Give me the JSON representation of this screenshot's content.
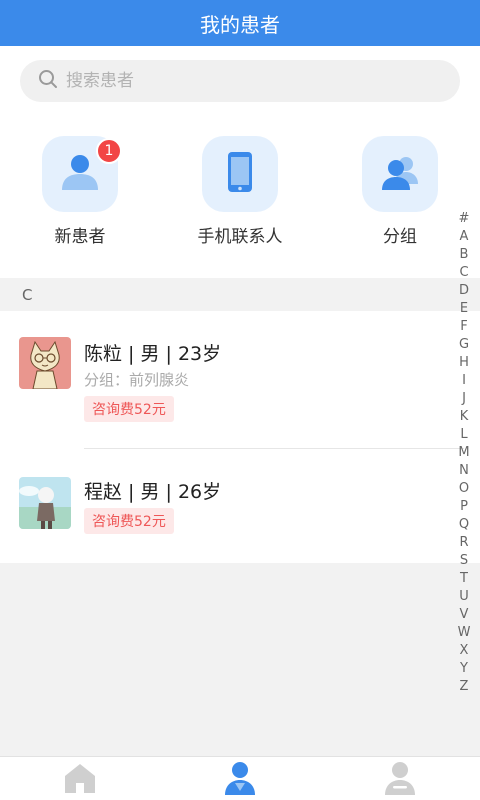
{
  "header": {
    "title": "我的患者"
  },
  "search": {
    "placeholder": "搜索患者"
  },
  "quick_actions": {
    "new_patients": {
      "label": "新患者",
      "badge": "1"
    },
    "contacts": {
      "label": "手机联系人"
    },
    "groups": {
      "label": "分组"
    }
  },
  "section": {
    "letter": "C"
  },
  "patients": [
    {
      "title": "陈粒 | 男 | 23岁",
      "group": "分组：前列腺炎",
      "fee": "咨询费52元"
    },
    {
      "title": "程赵 | 男 | 26岁",
      "fee": "咨询费52元"
    }
  ],
  "alphabet": [
    "#",
    "A",
    "B",
    "C",
    "D",
    "E",
    "F",
    "G",
    "H",
    "I",
    "J",
    "K",
    "L",
    "M",
    "N",
    "O",
    "P",
    "Q",
    "R",
    "S",
    "T",
    "U",
    "V",
    "W",
    "X",
    "Y",
    "Z"
  ],
  "colors": {
    "primary": "#3b8aea",
    "badge": "#f24545",
    "fee_text": "#ee5757",
    "fee_bg": "#fde8e8"
  },
  "tabs": [
    {
      "icon": "home-icon",
      "active": false
    },
    {
      "icon": "patients-icon",
      "active": true
    },
    {
      "icon": "profile-icon",
      "active": false
    }
  ]
}
